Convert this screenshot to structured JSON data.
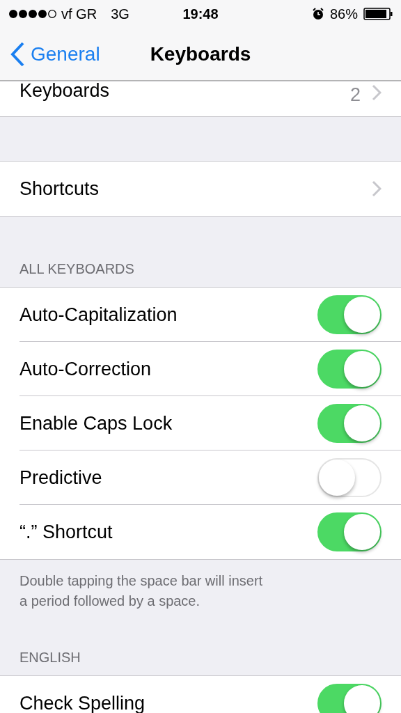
{
  "status_bar": {
    "carrier": "vf GR",
    "network": "3G",
    "time": "19:48",
    "battery": "86%"
  },
  "nav_bar": {
    "back": "General",
    "title": "Keyboards"
  },
  "groups": [
    {
      "rows": [
        {
          "kind": "link",
          "label": "Keyboards",
          "value": "2"
        }
      ]
    },
    {
      "rows": [
        {
          "kind": "link",
          "label": "Shortcuts"
        }
      ]
    },
    {
      "header": "ALL KEYBOARDS",
      "footer": "Double tapping the space bar will insert a period followed by a space.",
      "rows": [
        {
          "kind": "toggle",
          "label": "Auto-Capitalization",
          "on": true
        },
        {
          "kind": "toggle",
          "label": "Auto-Correction",
          "on": true
        },
        {
          "kind": "toggle",
          "label": "Enable Caps Lock",
          "on": true
        },
        {
          "kind": "toggle",
          "label": "Predictive",
          "on": false
        },
        {
          "kind": "toggle",
          "label": "“.” Shortcut",
          "on": true
        }
      ]
    },
    {
      "header": "ENGLISH",
      "rows": [
        {
          "kind": "toggle",
          "label": "Check Spelling",
          "on": true
        }
      ]
    }
  ]
}
